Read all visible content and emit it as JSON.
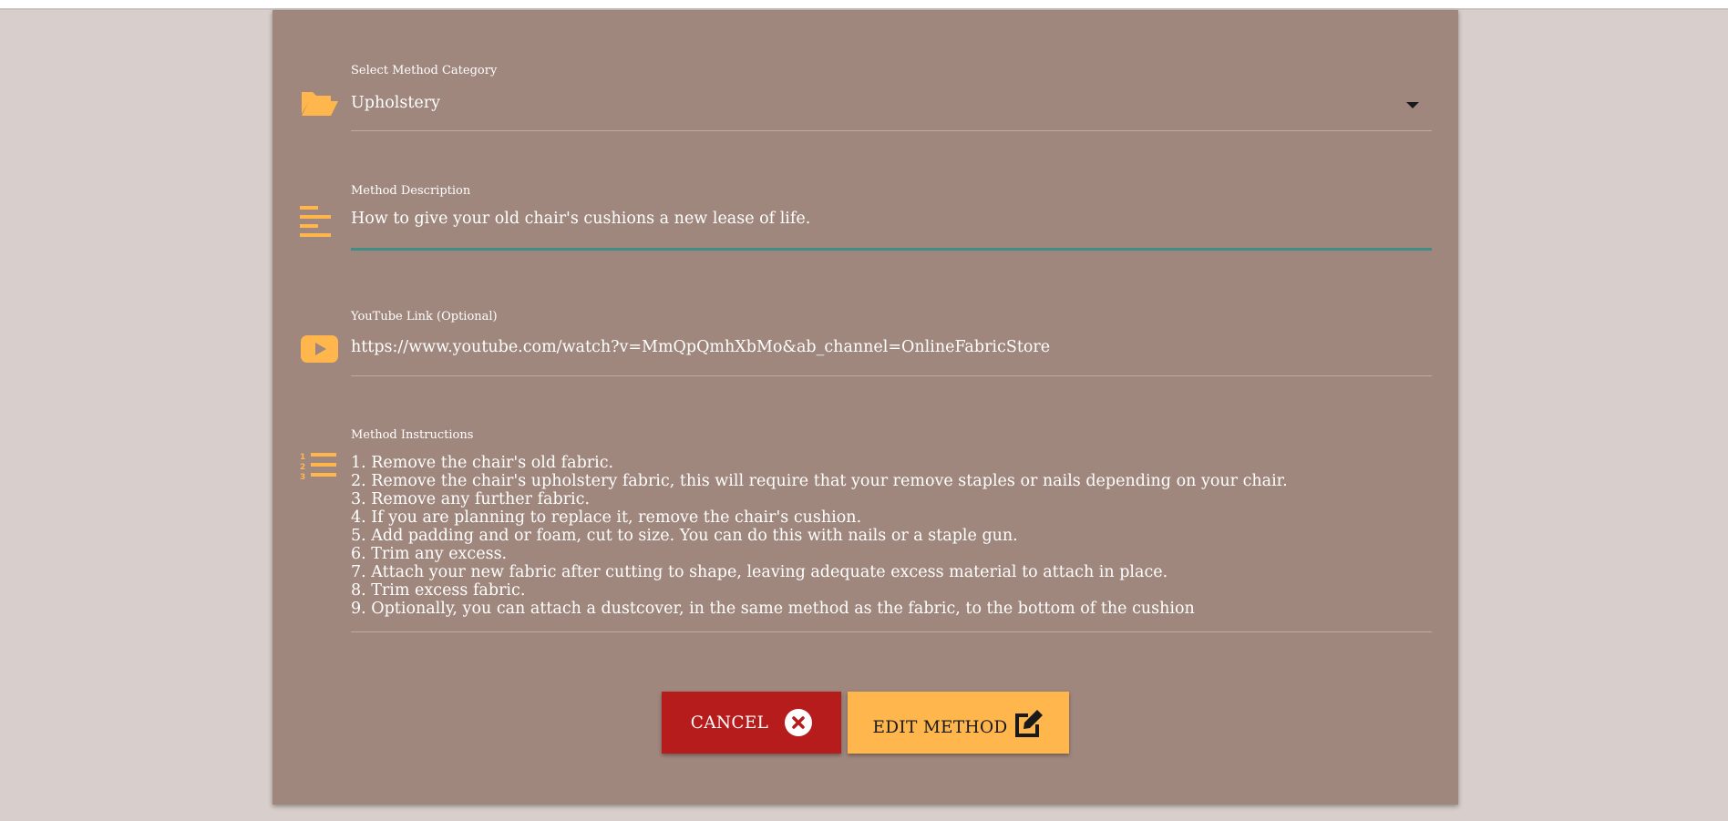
{
  "form": {
    "category": {
      "label": "Select Method Category",
      "value": "Upholstery",
      "icon": "folder-open-icon"
    },
    "description": {
      "label": "Method Description",
      "value": "How to give your old chair's cushions a new lease of life.",
      "icon": "align-left-icon"
    },
    "youtube": {
      "label": "YouTube Link (Optional)",
      "value": "https://www.youtube.com/watch?v=MmQpQmhXbMo&ab_channel=OnlineFabricStore",
      "icon": "youtube-icon"
    },
    "instructions": {
      "label": "Method Instructions",
      "icon": "list-ol-icon",
      "lines": [
        "1. Remove the chair's old fabric.",
        "2. Remove the chair's upholstery fabric, this will require that your remove staples or nails depending on your chair.",
        "3. Remove any further fabric.",
        "4. If you are planning to replace it, remove the chair's cushion.",
        "5. Add padding and or foam, cut to size. You can do this with nails or a staple gun.",
        "6. Trim any excess.",
        "7. Attach your new fabric after cutting to shape, leaving adequate excess material to attach in place.",
        "8. Trim excess fabric.",
        "9. Optionally, you can attach a dustcover, in the same method as the fabric, to the bottom of the cushion"
      ]
    }
  },
  "buttons": {
    "cancel_label": "CANCEL",
    "cancel_icon": "times-circle-icon",
    "edit_label": "EDIT METHOD",
    "edit_icon": "edit-icon"
  },
  "colors": {
    "card": "#a0877d",
    "accent": "#ffb74d",
    "cancel": "#b71c1c",
    "active_underline": "#3f8d86",
    "background": "#d8cecb"
  }
}
